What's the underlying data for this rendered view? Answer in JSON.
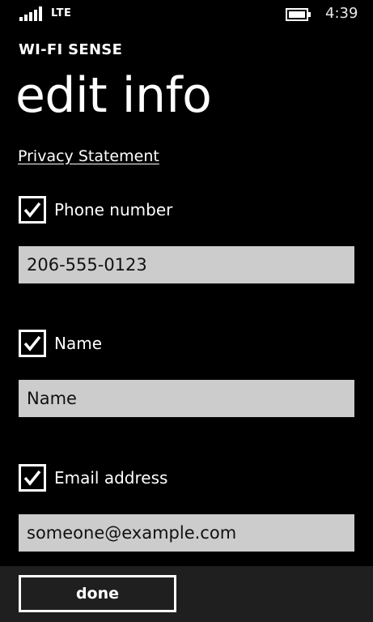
{
  "status_bar": {
    "signal_icon": "signal-strength-icon",
    "network": "LTE",
    "battery_icon": "battery-icon",
    "time": "4:39"
  },
  "header": {
    "app_title": "WI-FI SENSE",
    "page_title": "edit info"
  },
  "privacy_link": "Privacy Statement",
  "fields": [
    {
      "checkbox_label": "Phone number",
      "checked": true,
      "value": "206-555-0123",
      "placeholder": ""
    },
    {
      "checkbox_label": "Name",
      "checked": true,
      "value": "",
      "placeholder": "Name"
    },
    {
      "checkbox_label": "Email address",
      "checked": true,
      "value": "someone@example.com",
      "placeholder": ""
    }
  ],
  "app_bar": {
    "done_label": "done"
  },
  "colors": {
    "background": "#000000",
    "text": "#ffffff",
    "field_background": "#cccccc",
    "app_bar_background": "#1f1f1f"
  }
}
